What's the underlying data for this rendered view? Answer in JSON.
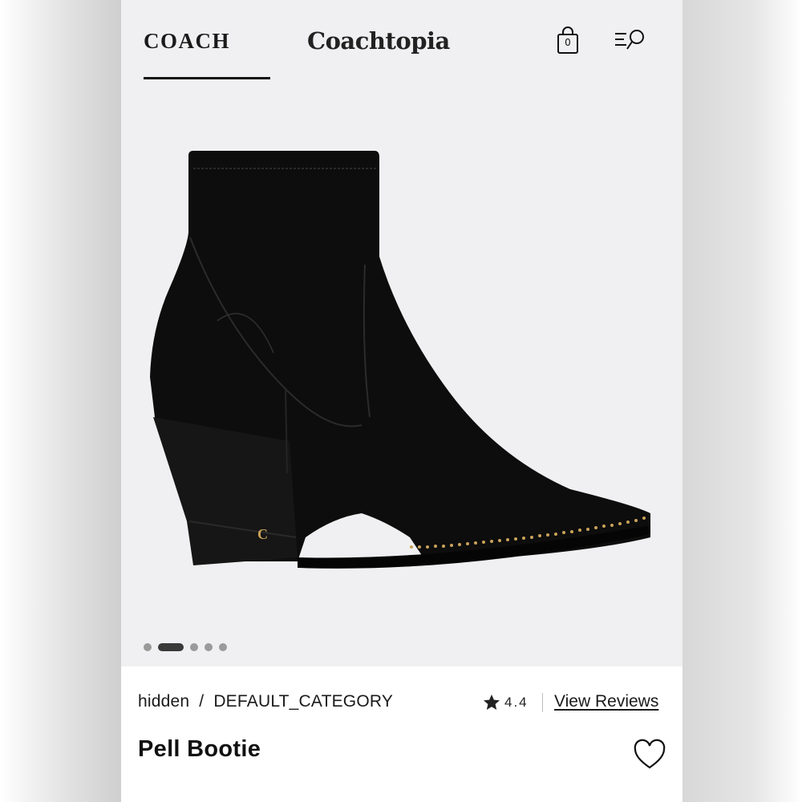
{
  "header": {
    "brand": "COACH",
    "sub_brand": "Coachtopia",
    "bag_count": "0",
    "icons": [
      "shopping-bag-icon",
      "menu-search-icon"
    ]
  },
  "gallery": {
    "image": "black leather ankle boot with stacked heel, pointed toe and gold bead trim",
    "total_slides": 5,
    "active_slide": 2
  },
  "product": {
    "breadcrumb": [
      "hidden",
      "DEFAULT_CATEGORY"
    ],
    "breadcrumb_separator": "/",
    "rating": "4.4",
    "reviews_link": "View Reviews",
    "title": "Pell Bootie"
  },
  "colors": {
    "background": "#f0f0f2",
    "ink": "#111111",
    "gold": "#c9a25a"
  }
}
